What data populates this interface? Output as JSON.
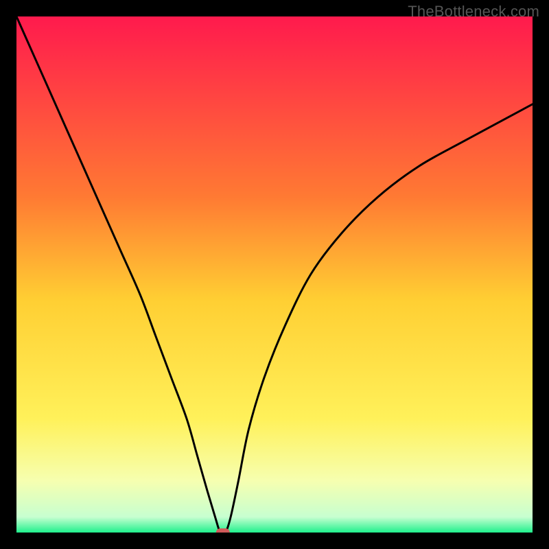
{
  "attribution": "TheBottleneck.com",
  "chart_data": {
    "type": "line",
    "title": "",
    "xlabel": "",
    "ylabel": "",
    "xlim": [
      0,
      100
    ],
    "ylim": [
      0,
      100
    ],
    "grid": false,
    "legend": false,
    "background_gradient": [
      {
        "pos": 0.0,
        "color": "#ff1a4d"
      },
      {
        "pos": 0.35,
        "color": "#ff7a33"
      },
      {
        "pos": 0.55,
        "color": "#ffcf33"
      },
      {
        "pos": 0.78,
        "color": "#fff15a"
      },
      {
        "pos": 0.9,
        "color": "#f6ffb0"
      },
      {
        "pos": 0.97,
        "color": "#c7ffd0"
      },
      {
        "pos": 1.0,
        "color": "#1ff08c"
      }
    ],
    "series": [
      {
        "name": "bottleneck-curve",
        "x": [
          0.0,
          4.0,
          8.0,
          12.0,
          16.0,
          20.0,
          24.0,
          27.0,
          30.0,
          33.0,
          35.0,
          37.0,
          38.5,
          39.5,
          40.5,
          41.5,
          43.0,
          45.0,
          48.0,
          52.0,
          57.0,
          63.0,
          70.0,
          78.0,
          87.0,
          100.0
        ],
        "values": [
          100.0,
          91.0,
          82.0,
          73.0,
          64.0,
          55.0,
          46.0,
          38.0,
          30.0,
          22.0,
          15.0,
          8.0,
          3.0,
          0.0,
          0.0,
          3.0,
          10.0,
          20.0,
          30.0,
          40.0,
          50.0,
          58.0,
          65.0,
          71.0,
          76.0,
          83.0
        ],
        "color": "#000000"
      }
    ],
    "marker": {
      "x": 40.0,
      "y": 0.0,
      "color": "#d05a5a",
      "shape": "rounded-pill"
    }
  }
}
